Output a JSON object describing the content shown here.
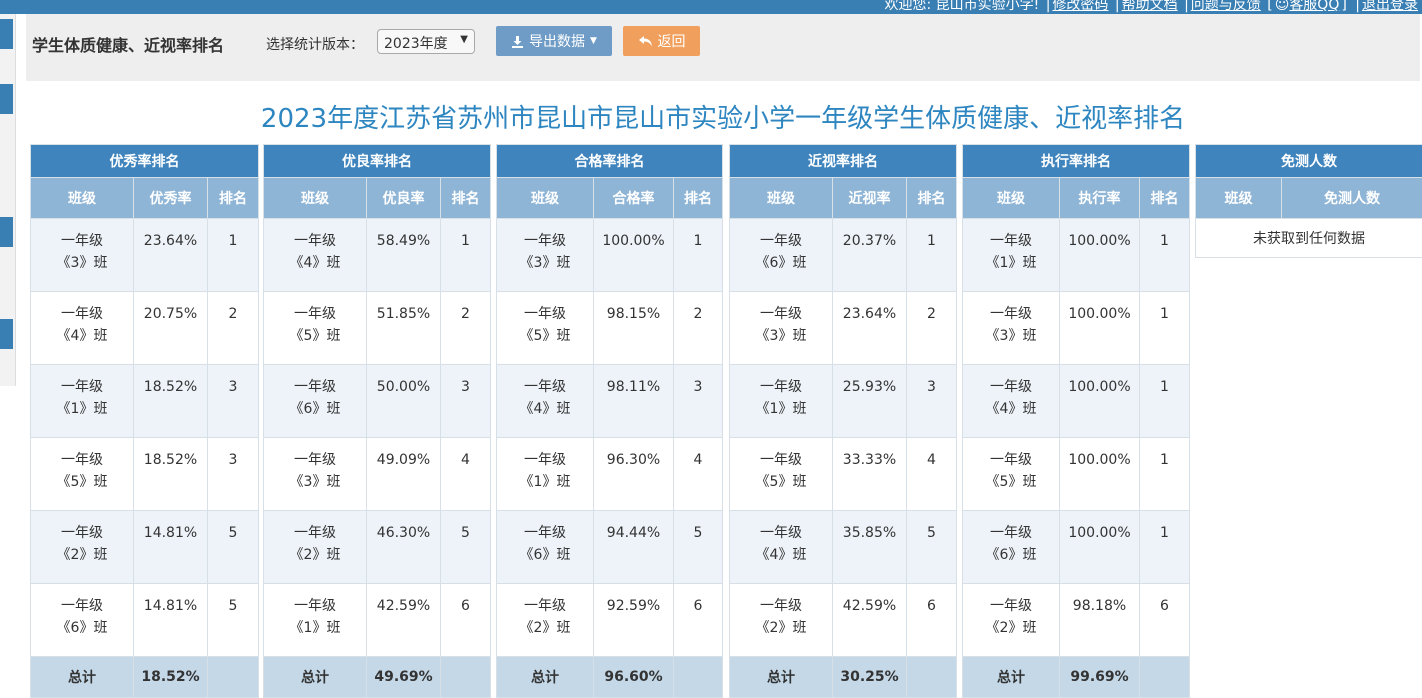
{
  "topbar": {
    "greeting": "欢迎您: 昆山市实验小学!",
    "links": [
      "修改密码",
      "帮助文档",
      "问题与反馈"
    ],
    "qq": "客服QQ",
    "logout": "退出登录"
  },
  "toolbar": {
    "title": "学生体质健康、近视率排名",
    "version_label": "选择统计版本：",
    "version_value": "2023年度",
    "export_label": "导出数据",
    "back_label": "返回"
  },
  "report_title": "2023年度江苏省苏州市昆山市昆山市实验小学一年级学生体质健康、近视率排名",
  "tables": [
    {
      "title": "优秀率排名",
      "columns": [
        "班级",
        "优秀率",
        "排名"
      ],
      "rows": [
        {
          "grade": "一年级",
          "class": "《3》班",
          "rate": "23.64%",
          "rank": "1"
        },
        {
          "grade": "一年级",
          "class": "《4》班",
          "rate": "20.75%",
          "rank": "2"
        },
        {
          "grade": "一年级",
          "class": "《1》班",
          "rate": "18.52%",
          "rank": "3"
        },
        {
          "grade": "一年级",
          "class": "《5》班",
          "rate": "18.52%",
          "rank": "3"
        },
        {
          "grade": "一年级",
          "class": "《2》班",
          "rate": "14.81%",
          "rank": "5"
        },
        {
          "grade": "一年级",
          "class": "《6》班",
          "rate": "14.81%",
          "rank": "5"
        }
      ],
      "total_label": "总计",
      "total_value": "18.52%"
    },
    {
      "title": "优良率排名",
      "columns": [
        "班级",
        "优良率",
        "排名"
      ],
      "rows": [
        {
          "grade": "一年级",
          "class": "《4》班",
          "rate": "58.49%",
          "rank": "1"
        },
        {
          "grade": "一年级",
          "class": "《5》班",
          "rate": "51.85%",
          "rank": "2"
        },
        {
          "grade": "一年级",
          "class": "《6》班",
          "rate": "50.00%",
          "rank": "3"
        },
        {
          "grade": "一年级",
          "class": "《3》班",
          "rate": "49.09%",
          "rank": "4"
        },
        {
          "grade": "一年级",
          "class": "《2》班",
          "rate": "46.30%",
          "rank": "5"
        },
        {
          "grade": "一年级",
          "class": "《1》班",
          "rate": "42.59%",
          "rank": "6"
        }
      ],
      "total_label": "总计",
      "total_value": "49.69%"
    },
    {
      "title": "合格率排名",
      "columns": [
        "班级",
        "合格率",
        "排名"
      ],
      "rows": [
        {
          "grade": "一年级",
          "class": "《3》班",
          "rate": "100.00%",
          "rank": "1"
        },
        {
          "grade": "一年级",
          "class": "《5》班",
          "rate": "98.15%",
          "rank": "2"
        },
        {
          "grade": "一年级",
          "class": "《4》班",
          "rate": "98.11%",
          "rank": "3"
        },
        {
          "grade": "一年级",
          "class": "《1》班",
          "rate": "96.30%",
          "rank": "4"
        },
        {
          "grade": "一年级",
          "class": "《6》班",
          "rate": "94.44%",
          "rank": "5"
        },
        {
          "grade": "一年级",
          "class": "《2》班",
          "rate": "92.59%",
          "rank": "6"
        }
      ],
      "total_label": "总计",
      "total_value": "96.60%"
    },
    {
      "title": "近视率排名",
      "columns": [
        "班级",
        "近视率",
        "排名"
      ],
      "rows": [
        {
          "grade": "一年级",
          "class": "《6》班",
          "rate": "20.37%",
          "rank": "1"
        },
        {
          "grade": "一年级",
          "class": "《3》班",
          "rate": "23.64%",
          "rank": "2"
        },
        {
          "grade": "一年级",
          "class": "《1》班",
          "rate": "25.93%",
          "rank": "3"
        },
        {
          "grade": "一年级",
          "class": "《5》班",
          "rate": "33.33%",
          "rank": "4"
        },
        {
          "grade": "一年级",
          "class": "《4》班",
          "rate": "35.85%",
          "rank": "5"
        },
        {
          "grade": "一年级",
          "class": "《2》班",
          "rate": "42.59%",
          "rank": "6"
        }
      ],
      "total_label": "总计",
      "total_value": "30.25%"
    },
    {
      "title": "执行率排名",
      "columns": [
        "班级",
        "执行率",
        "排名"
      ],
      "rows": [
        {
          "grade": "一年级",
          "class": "《1》班",
          "rate": "100.00%",
          "rank": "1"
        },
        {
          "grade": "一年级",
          "class": "《3》班",
          "rate": "100.00%",
          "rank": "1"
        },
        {
          "grade": "一年级",
          "class": "《4》班",
          "rate": "100.00%",
          "rank": "1"
        },
        {
          "grade": "一年级",
          "class": "《5》班",
          "rate": "100.00%",
          "rank": "1"
        },
        {
          "grade": "一年级",
          "class": "《6》班",
          "rate": "100.00%",
          "rank": "1"
        },
        {
          "grade": "一年级",
          "class": "《2》班",
          "rate": "98.18%",
          "rank": "6"
        }
      ],
      "total_label": "总计",
      "total_value": "99.69%"
    }
  ],
  "exempt_table": {
    "title": "免测人数",
    "columns": [
      "班级",
      "免测人数"
    ],
    "empty_text": "未获取到任何数据"
  },
  "colors": {
    "topbar": "#3a7fb4",
    "table_header": "#3f84bd",
    "column_header": "#8fb5d6",
    "total_row": "#c4d8e8",
    "export_button": "#6f9cc6",
    "back_button": "#f0a05c",
    "report_title": "#2e86c1"
  }
}
